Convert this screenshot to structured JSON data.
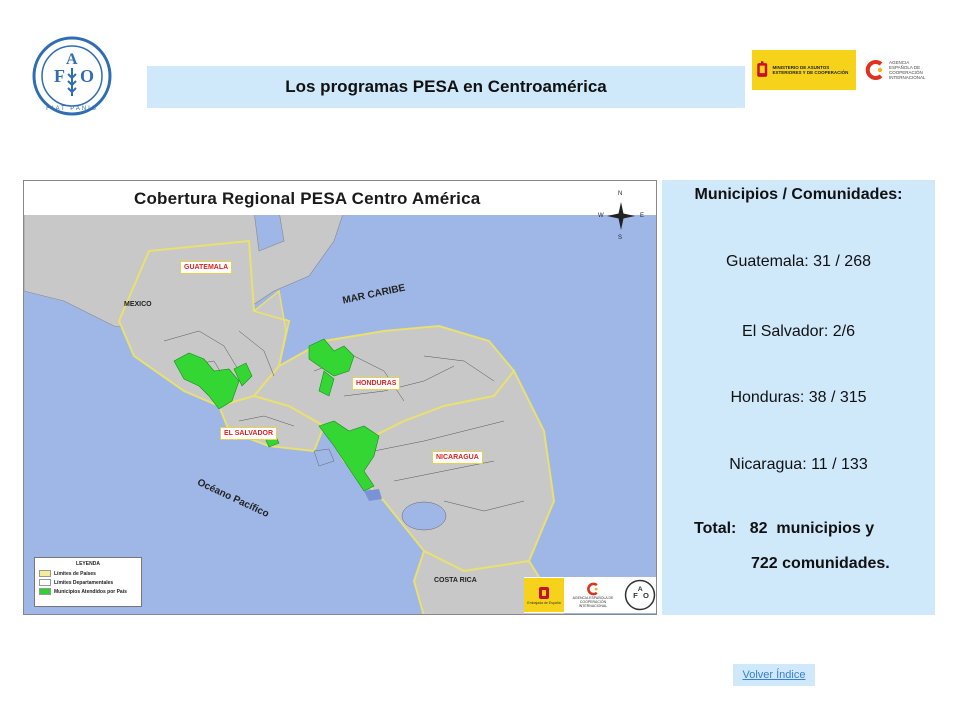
{
  "header": {
    "title": "Los programas PESA en Centroamérica",
    "fao_letters": [
      "F",
      "A",
      "O"
    ],
    "fao_motto": "FIAT PANIS"
  },
  "sponsors": {
    "spain_ministry": "MINISTERIO DE ASUNTOS EXTERIORES Y DE COOPERACIÓN",
    "aecid": "AGENCIA ESPAÑOLA DE COOPERACIÓN INTERNACIONAL"
  },
  "map": {
    "title": "Cobertura Regional PESA Centro América",
    "compass": {
      "n": "N",
      "s": "S",
      "e": "E",
      "w": "W"
    },
    "countries": {
      "guatemala": "GUATEMALA",
      "mexico": "MEXICO",
      "honduras": "HONDURAS",
      "el_salvador": "EL SALVADOR",
      "nicaragua": "NICARAGUA",
      "costa_rica": "COSTA RICA"
    },
    "seas": {
      "caribbean": "MAR CARIBE",
      "pacific": "Océano Pacífico"
    },
    "legend": {
      "title": "LEYENDA",
      "items": [
        {
          "label": "Límites de Países",
          "color": "#f3ec9a"
        },
        {
          "label": "Límites Departamentales",
          "color": "#ffffff"
        },
        {
          "label": "Municipios Atendidos por País",
          "color": "#2fd02f"
        }
      ]
    },
    "footer": {
      "embassy": "Embajada de España",
      "aecid_short": "AGENCIA ESPAÑOLA DE COOPERACIÓN INTERNACIONAL"
    },
    "colors": {
      "sea": "#9fb7e6",
      "land": "#c8c8c8",
      "country_border": "#e8e070",
      "served": "#33d633"
    }
  },
  "info": {
    "heading": "Municipios / Comunidades:",
    "lines": [
      "Guatemala: 31  / 268",
      "El Salvador: 2/6",
      "Honduras: 38 / 315",
      "Nicaragua: 11 / 133"
    ],
    "total_line1": "Total:   82  municipios y",
    "total_line2": "722  comunidades."
  },
  "nav": {
    "back_label": "Volver Índice"
  }
}
